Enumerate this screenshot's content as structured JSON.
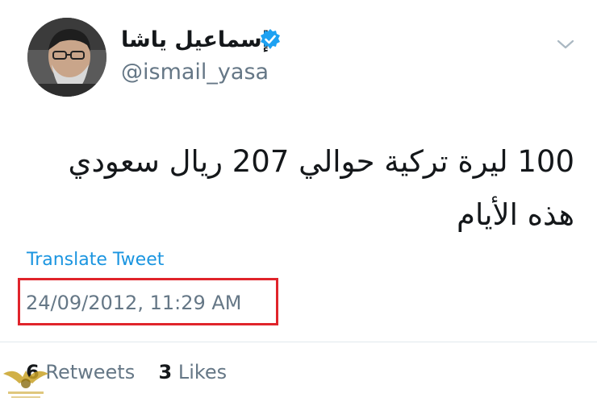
{
  "tweet": {
    "author": {
      "display_name": "إسماعيل ياشا",
      "handle": "@ismail_yasa",
      "verified": true,
      "verified_icon": "verified-badge-icon"
    },
    "menu_icon": "chevron-down-icon",
    "text": "100 ليرة تركية حوالي 207 ريال سعودي هذه الأيام",
    "translate_label": "Translate Tweet",
    "timestamp": "24/09/2012, 11:29 AM",
    "stats": {
      "retweets_count": "6",
      "retweets_label": "Retweets",
      "likes_count": "3",
      "likes_label": "Likes"
    }
  },
  "colors": {
    "link": "#1b95e0",
    "muted": "#657786",
    "text": "#14171a",
    "highlight_box": "#e0242b",
    "verified_badge": "#1da1f2"
  }
}
